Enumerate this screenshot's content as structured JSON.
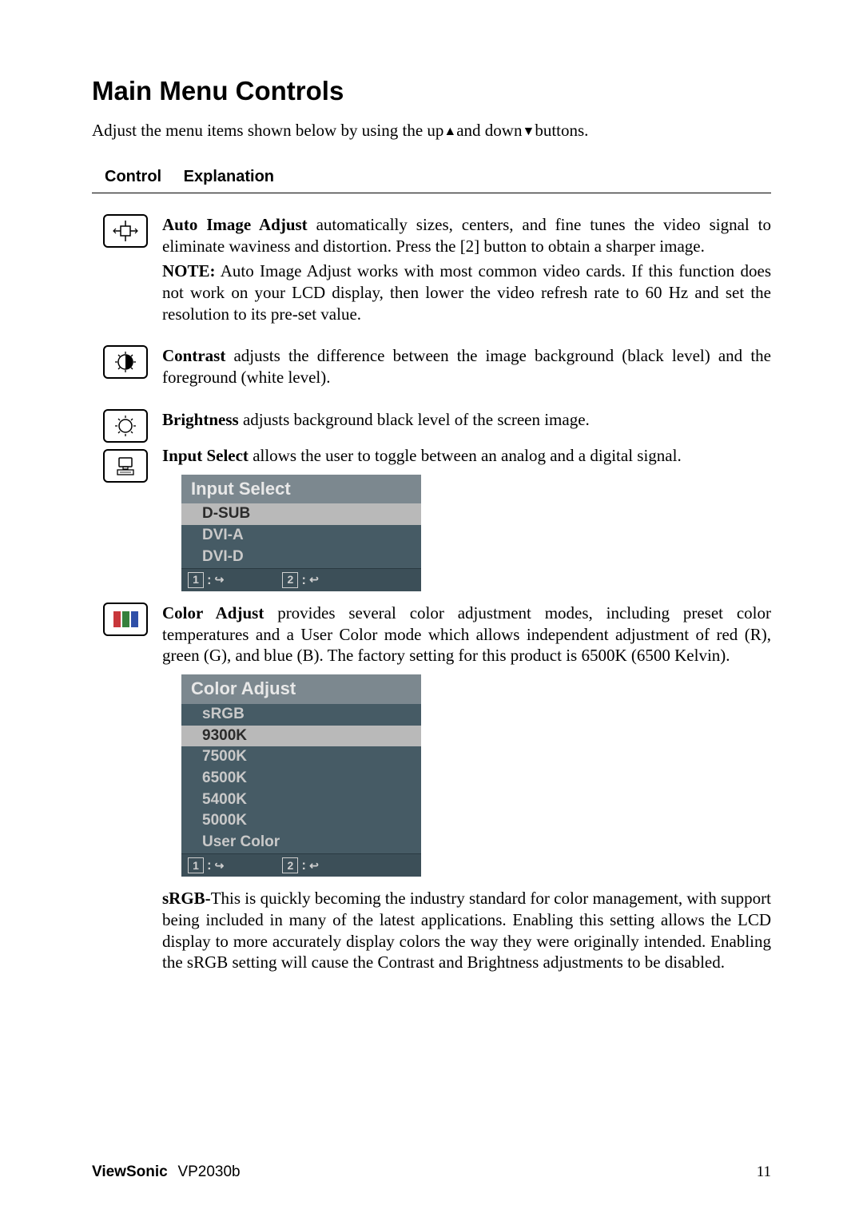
{
  "title": "Main Menu Controls",
  "intro_pre": "Adjust the menu items shown below by using the up",
  "intro_mid": "and down",
  "intro_post": "buttons.",
  "headers": {
    "c1": "Control",
    "c2": "Explanation"
  },
  "auto": {
    "name": "Auto Image Adjust",
    "text": " automatically sizes, centers, and fine tunes the video signal to eliminate waviness and distortion. Press the [2] button to obtain a sharper image.",
    "note_label": "NOTE:",
    "note_text": " Auto Image Adjust works with most common video cards. If this function does not work on your LCD display, then lower the video refresh rate to 60 Hz and set the resolution to its pre-set value."
  },
  "contrast": {
    "name": "Contrast",
    "text": " adjusts the difference between the image background  (black level) and the foreground (white level)."
  },
  "brightness": {
    "name": "Brightness",
    "text": " adjusts background black level of the screen image."
  },
  "inputselect": {
    "name": "Input Select",
    "text": " allows the user to toggle between an analog and a digital signal.",
    "osd_title": "Input Select",
    "items": [
      "D-SUB",
      "DVI-A",
      "DVI-D"
    ]
  },
  "coloradjust": {
    "name": "Color Adjust",
    "text": " provides several color adjustment modes, including preset color temperatures and a User Color mode which allows independent adjustment of red (R), green (G), and blue (B). The factory setting for this product is 6500K (6500 Kelvin).",
    "osd_title": "Color Adjust",
    "items": [
      "sRGB",
      "9300K",
      "7500K",
      "6500K",
      "5400K",
      "5000K",
      "User Color"
    ]
  },
  "srgb": {
    "name": "sRGB-",
    "text": "This is quickly becoming the industry standard for color management, with support being included in many of the latest applications. Enabling this setting allows the LCD display to more accurately display colors the way they were originally intended. Enabling the sRGB setting will cause the Contrast and Brightness adjustments to be disabled."
  },
  "osd_nav": {
    "k1": "1",
    "k2": "2"
  },
  "footer": {
    "brand": "ViewSonic",
    "model": "VP2030b",
    "page": "11"
  }
}
